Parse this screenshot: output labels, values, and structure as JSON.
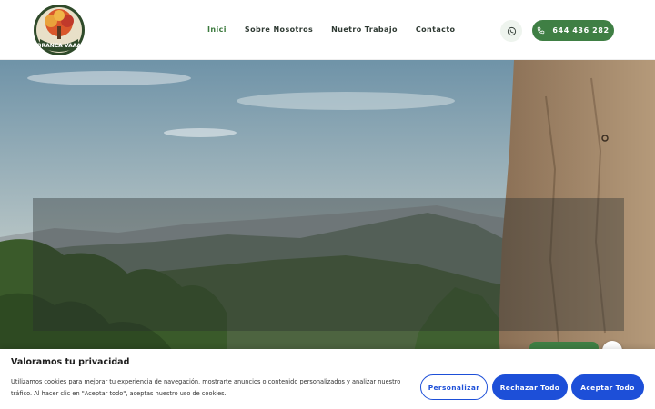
{
  "header": {
    "logo_text": "BRANCA VAAA",
    "nav": [
      {
        "label": "Inici",
        "active": true
      },
      {
        "label": "Sobre Nosotros",
        "active": false
      },
      {
        "label": "Nuetro Trabajo",
        "active": false
      },
      {
        "label": "Contacto",
        "active": false
      }
    ],
    "whatsapp_icon": "whatsapp-icon",
    "phone_icon": "phone-icon",
    "phone_label": "644 436 282"
  },
  "colors": {
    "brand_green": "#3f7f44",
    "cookie_blue": "#1d4fd8"
  },
  "cookie": {
    "title": "Valoramos tu privacidad",
    "text": "Utilizamos cookies para mejorar tu experiencia de navegación, mostrarte anuncios o contenido personalizados y analizar nuestro tráfico. Al hacer clic en \"Aceptar todo\", aceptas nuestro uso de cookies.",
    "buttons": {
      "customize": "Personalizar",
      "reject": "Rechazar Todo",
      "accept": "Aceptar Todo"
    }
  }
}
